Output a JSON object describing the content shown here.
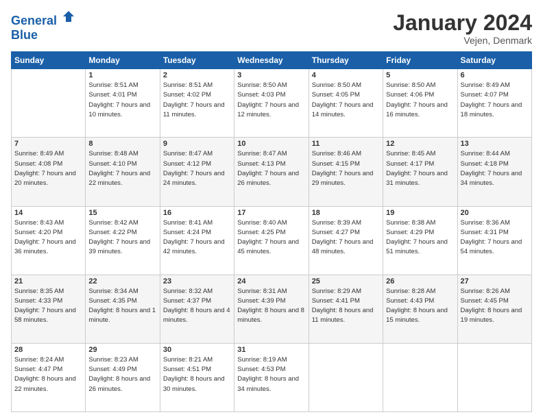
{
  "logo": {
    "line1": "General",
    "line2": "Blue"
  },
  "header": {
    "month": "January 2024",
    "location": "Vejen, Denmark"
  },
  "weekdays": [
    "Sunday",
    "Monday",
    "Tuesday",
    "Wednesday",
    "Thursday",
    "Friday",
    "Saturday"
  ],
  "weeks": [
    [
      {
        "day": "",
        "sunrise": "",
        "sunset": "",
        "daylight": ""
      },
      {
        "day": "1",
        "sunrise": "Sunrise: 8:51 AM",
        "sunset": "Sunset: 4:01 PM",
        "daylight": "Daylight: 7 hours and 10 minutes."
      },
      {
        "day": "2",
        "sunrise": "Sunrise: 8:51 AM",
        "sunset": "Sunset: 4:02 PM",
        "daylight": "Daylight: 7 hours and 11 minutes."
      },
      {
        "day": "3",
        "sunrise": "Sunrise: 8:50 AM",
        "sunset": "Sunset: 4:03 PM",
        "daylight": "Daylight: 7 hours and 12 minutes."
      },
      {
        "day": "4",
        "sunrise": "Sunrise: 8:50 AM",
        "sunset": "Sunset: 4:05 PM",
        "daylight": "Daylight: 7 hours and 14 minutes."
      },
      {
        "day": "5",
        "sunrise": "Sunrise: 8:50 AM",
        "sunset": "Sunset: 4:06 PM",
        "daylight": "Daylight: 7 hours and 16 minutes."
      },
      {
        "day": "6",
        "sunrise": "Sunrise: 8:49 AM",
        "sunset": "Sunset: 4:07 PM",
        "daylight": "Daylight: 7 hours and 18 minutes."
      }
    ],
    [
      {
        "day": "7",
        "sunrise": "Sunrise: 8:49 AM",
        "sunset": "Sunset: 4:08 PM",
        "daylight": "Daylight: 7 hours and 20 minutes."
      },
      {
        "day": "8",
        "sunrise": "Sunrise: 8:48 AM",
        "sunset": "Sunset: 4:10 PM",
        "daylight": "Daylight: 7 hours and 22 minutes."
      },
      {
        "day": "9",
        "sunrise": "Sunrise: 8:47 AM",
        "sunset": "Sunset: 4:12 PM",
        "daylight": "Daylight: 7 hours and 24 minutes."
      },
      {
        "day": "10",
        "sunrise": "Sunrise: 8:47 AM",
        "sunset": "Sunset: 4:13 PM",
        "daylight": "Daylight: 7 hours and 26 minutes."
      },
      {
        "day": "11",
        "sunrise": "Sunrise: 8:46 AM",
        "sunset": "Sunset: 4:15 PM",
        "daylight": "Daylight: 7 hours and 29 minutes."
      },
      {
        "day": "12",
        "sunrise": "Sunrise: 8:45 AM",
        "sunset": "Sunset: 4:17 PM",
        "daylight": "Daylight: 7 hours and 31 minutes."
      },
      {
        "day": "13",
        "sunrise": "Sunrise: 8:44 AM",
        "sunset": "Sunset: 4:18 PM",
        "daylight": "Daylight: 7 hours and 34 minutes."
      }
    ],
    [
      {
        "day": "14",
        "sunrise": "Sunrise: 8:43 AM",
        "sunset": "Sunset: 4:20 PM",
        "daylight": "Daylight: 7 hours and 36 minutes."
      },
      {
        "day": "15",
        "sunrise": "Sunrise: 8:42 AM",
        "sunset": "Sunset: 4:22 PM",
        "daylight": "Daylight: 7 hours and 39 minutes."
      },
      {
        "day": "16",
        "sunrise": "Sunrise: 8:41 AM",
        "sunset": "Sunset: 4:24 PM",
        "daylight": "Daylight: 7 hours and 42 minutes."
      },
      {
        "day": "17",
        "sunrise": "Sunrise: 8:40 AM",
        "sunset": "Sunset: 4:25 PM",
        "daylight": "Daylight: 7 hours and 45 minutes."
      },
      {
        "day": "18",
        "sunrise": "Sunrise: 8:39 AM",
        "sunset": "Sunset: 4:27 PM",
        "daylight": "Daylight: 7 hours and 48 minutes."
      },
      {
        "day": "19",
        "sunrise": "Sunrise: 8:38 AM",
        "sunset": "Sunset: 4:29 PM",
        "daylight": "Daylight: 7 hours and 51 minutes."
      },
      {
        "day": "20",
        "sunrise": "Sunrise: 8:36 AM",
        "sunset": "Sunset: 4:31 PM",
        "daylight": "Daylight: 7 hours and 54 minutes."
      }
    ],
    [
      {
        "day": "21",
        "sunrise": "Sunrise: 8:35 AM",
        "sunset": "Sunset: 4:33 PM",
        "daylight": "Daylight: 7 hours and 58 minutes."
      },
      {
        "day": "22",
        "sunrise": "Sunrise: 8:34 AM",
        "sunset": "Sunset: 4:35 PM",
        "daylight": "Daylight: 8 hours and 1 minute."
      },
      {
        "day": "23",
        "sunrise": "Sunrise: 8:32 AM",
        "sunset": "Sunset: 4:37 PM",
        "daylight": "Daylight: 8 hours and 4 minutes."
      },
      {
        "day": "24",
        "sunrise": "Sunrise: 8:31 AM",
        "sunset": "Sunset: 4:39 PM",
        "daylight": "Daylight: 8 hours and 8 minutes."
      },
      {
        "day": "25",
        "sunrise": "Sunrise: 8:29 AM",
        "sunset": "Sunset: 4:41 PM",
        "daylight": "Daylight: 8 hours and 11 minutes."
      },
      {
        "day": "26",
        "sunrise": "Sunrise: 8:28 AM",
        "sunset": "Sunset: 4:43 PM",
        "daylight": "Daylight: 8 hours and 15 minutes."
      },
      {
        "day": "27",
        "sunrise": "Sunrise: 8:26 AM",
        "sunset": "Sunset: 4:45 PM",
        "daylight": "Daylight: 8 hours and 19 minutes."
      }
    ],
    [
      {
        "day": "28",
        "sunrise": "Sunrise: 8:24 AM",
        "sunset": "Sunset: 4:47 PM",
        "daylight": "Daylight: 8 hours and 22 minutes."
      },
      {
        "day": "29",
        "sunrise": "Sunrise: 8:23 AM",
        "sunset": "Sunset: 4:49 PM",
        "daylight": "Daylight: 8 hours and 26 minutes."
      },
      {
        "day": "30",
        "sunrise": "Sunrise: 8:21 AM",
        "sunset": "Sunset: 4:51 PM",
        "daylight": "Daylight: 8 hours and 30 minutes."
      },
      {
        "day": "31",
        "sunrise": "Sunrise: 8:19 AM",
        "sunset": "Sunset: 4:53 PM",
        "daylight": "Daylight: 8 hours and 34 minutes."
      },
      {
        "day": "",
        "sunrise": "",
        "sunset": "",
        "daylight": ""
      },
      {
        "day": "",
        "sunrise": "",
        "sunset": "",
        "daylight": ""
      },
      {
        "day": "",
        "sunrise": "",
        "sunset": "",
        "daylight": ""
      }
    ]
  ]
}
